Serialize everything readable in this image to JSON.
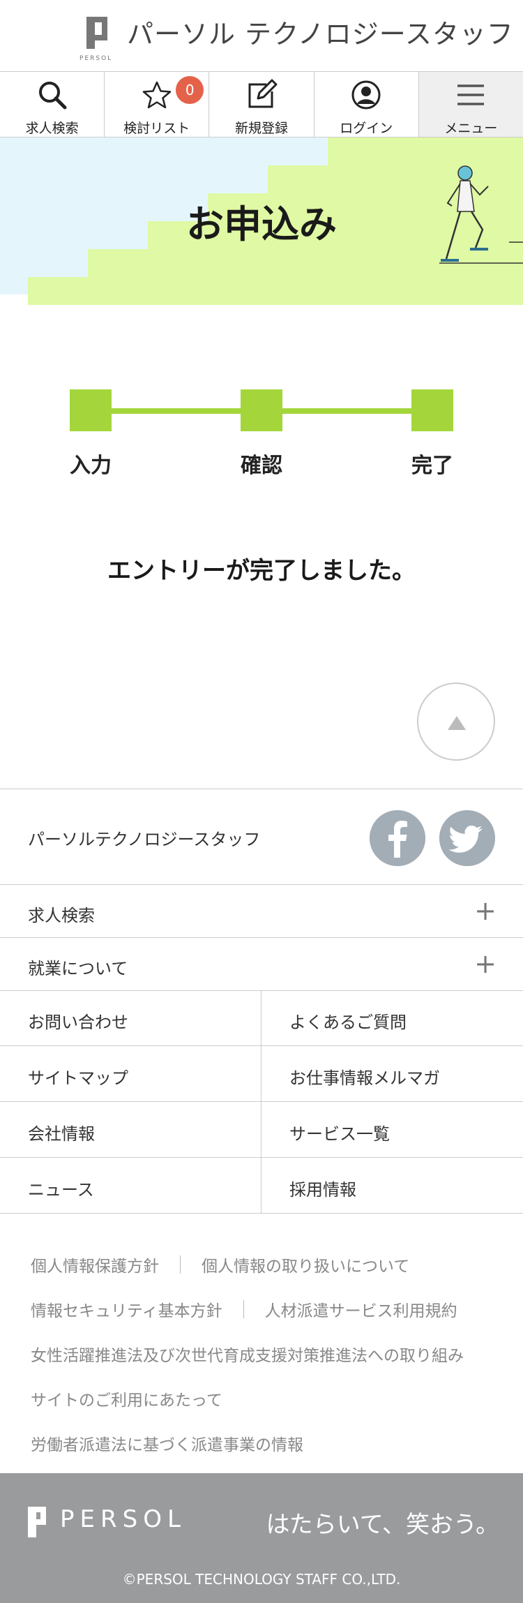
{
  "header": {
    "logo_small": "PERSOL",
    "site_name": "パーソル テクノロジースタッフ"
  },
  "nav": {
    "items": [
      {
        "label": "求人検索",
        "icon": "search-icon"
      },
      {
        "label": "検討リスト",
        "icon": "star-icon",
        "badge": "0"
      },
      {
        "label": "新規登録",
        "icon": "edit-icon"
      },
      {
        "label": "ログイン",
        "icon": "user-icon"
      },
      {
        "label": "メニュー",
        "icon": "hamburger-icon"
      }
    ]
  },
  "hero": {
    "title": "お申込み",
    "colors": {
      "light_blue": "#e4f6fb",
      "lime": "#dff9a4"
    }
  },
  "steps": {
    "items": [
      "入力",
      "確認",
      "完了"
    ],
    "current_index": 2,
    "color": "#a4d63c"
  },
  "message": "エントリーが完了しました。",
  "footer": {
    "company_name": "パーソルテクノロジースタッフ",
    "sns": [
      "facebook-icon",
      "twitter-icon"
    ],
    "accordions": [
      "求人検索",
      "就業について"
    ],
    "grid": [
      [
        "お問い合わせ",
        "よくあるご質問"
      ],
      [
        "サイトマップ",
        "お仕事情報メルマガ"
      ],
      [
        "会社情報",
        "サービス一覧"
      ],
      [
        "ニュース",
        "採用情報"
      ]
    ],
    "links": {
      "row1": [
        "個人情報保護方針",
        "個人情報の取り扱いについて"
      ],
      "row2": [
        "情報セキュリティ基本方針",
        "人材派遣サービス利用規約"
      ],
      "row3": "女性活躍推進法及び次世代育成支援対策推進法への取り組み",
      "row4": "サイトのご利用にあたって",
      "row5": "労働者派遣法に基づく派遣事業の情報"
    },
    "brand": "PERSOL",
    "slogan": "はたらいて、笑おう。",
    "copyright": "©PERSOL TECHNOLOGY STAFF CO.,LTD."
  }
}
